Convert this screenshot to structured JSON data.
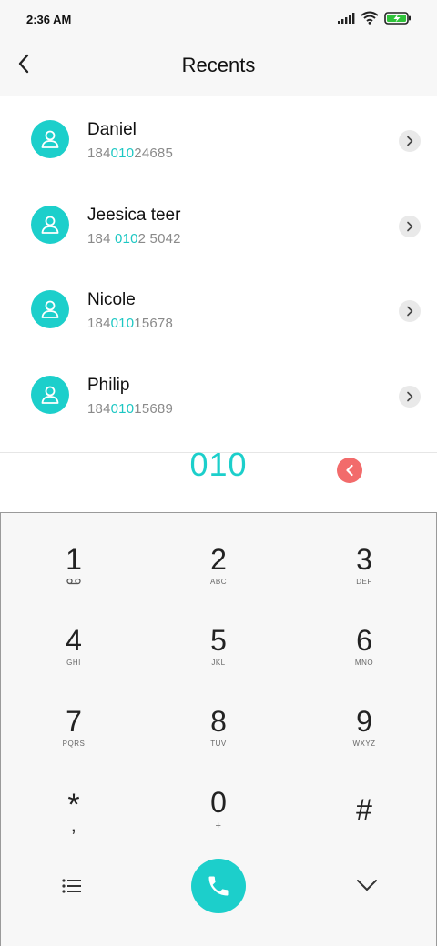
{
  "status_bar": {
    "time": "2:36 AM",
    "icons": [
      "signal-icon",
      "wifi-icon",
      "battery-charging-icon"
    ],
    "battery_color": "#2fc23a"
  },
  "header": {
    "title": "Recents",
    "back_icon": "chevron-left-icon"
  },
  "contacts": [
    {
      "name": "Daniel",
      "number_pre": "184",
      "number_match": "010",
      "number_post": "24685"
    },
    {
      "name": "Jeesica teer",
      "number_pre": "184 ",
      "number_match": "010",
      "number_post": "2 5042"
    },
    {
      "name": "Nicole",
      "number_pre": "184",
      "number_match": "010",
      "number_post": "15678"
    },
    {
      "name": "Philip",
      "number_pre": "184",
      "number_match": "010",
      "number_post": "15689"
    }
  ],
  "dialer": {
    "input_value": "010",
    "accent_color": "#1ccfcb",
    "delete_color": "#f26b6b"
  },
  "keypad": {
    "keys": [
      {
        "digit": "1",
        "letters": ""
      },
      {
        "digit": "2",
        "letters": "ABC"
      },
      {
        "digit": "3",
        "letters": "DEF"
      },
      {
        "digit": "4",
        "letters": "GHI"
      },
      {
        "digit": "5",
        "letters": "JKL"
      },
      {
        "digit": "6",
        "letters": "MNO"
      },
      {
        "digit": "7",
        "letters": "PQRS"
      },
      {
        "digit": "8",
        "letters": "TUV"
      },
      {
        "digit": "9",
        "letters": "WXYZ"
      },
      {
        "digit": "*",
        "letters": ","
      },
      {
        "digit": "0",
        "letters": "+"
      },
      {
        "digit": "#",
        "letters": ""
      }
    ]
  }
}
